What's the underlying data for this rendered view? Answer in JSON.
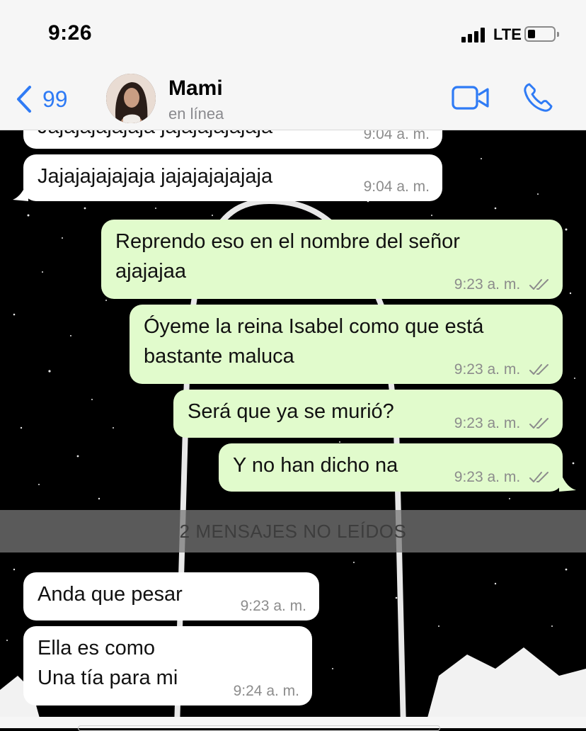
{
  "status_bar": {
    "time": "9:26",
    "network": "LTE"
  },
  "header": {
    "back_count": "99",
    "contact_name": "Mami",
    "contact_status": "en línea"
  },
  "messages": [
    {
      "direction": "in",
      "text": "Jajajajajajaja jajajajajajaja",
      "time": "9:04 a. m."
    },
    {
      "direction": "in",
      "text": "Jajajajajajaja jajajajajajaja",
      "time": "9:04 a. m."
    },
    {
      "direction": "out",
      "line1": "Reprendo eso en el nombre del señor",
      "line2": "ajajajaa",
      "time": "9:23 a. m."
    },
    {
      "direction": "out",
      "line1": "Óyeme la reina Isabel como que está",
      "line2": "bastante maluca",
      "time": "9:23 a. m."
    },
    {
      "direction": "out",
      "text": "Será que ya se murió?",
      "time": "9:23 a. m."
    },
    {
      "direction": "out",
      "text": "Y no han dicho na",
      "time": "9:23 a. m."
    },
    {
      "direction": "in",
      "text": "Anda que pesar",
      "time": "9:23 a. m."
    },
    {
      "direction": "in",
      "line1": "Ella es como",
      "line2": "Una tía para mi",
      "time": "9:24 a. m."
    }
  ],
  "unread_banner": "2 MENSAJES NO LEÍDOS",
  "colors": {
    "accent": "#2f7bf5",
    "outgoing_bubble": "#e1fbcc",
    "incoming_bubble": "#ffffff"
  },
  "icons": [
    "back-chevron-icon",
    "video-call-icon",
    "phone-call-icon",
    "double-check-icon"
  ]
}
